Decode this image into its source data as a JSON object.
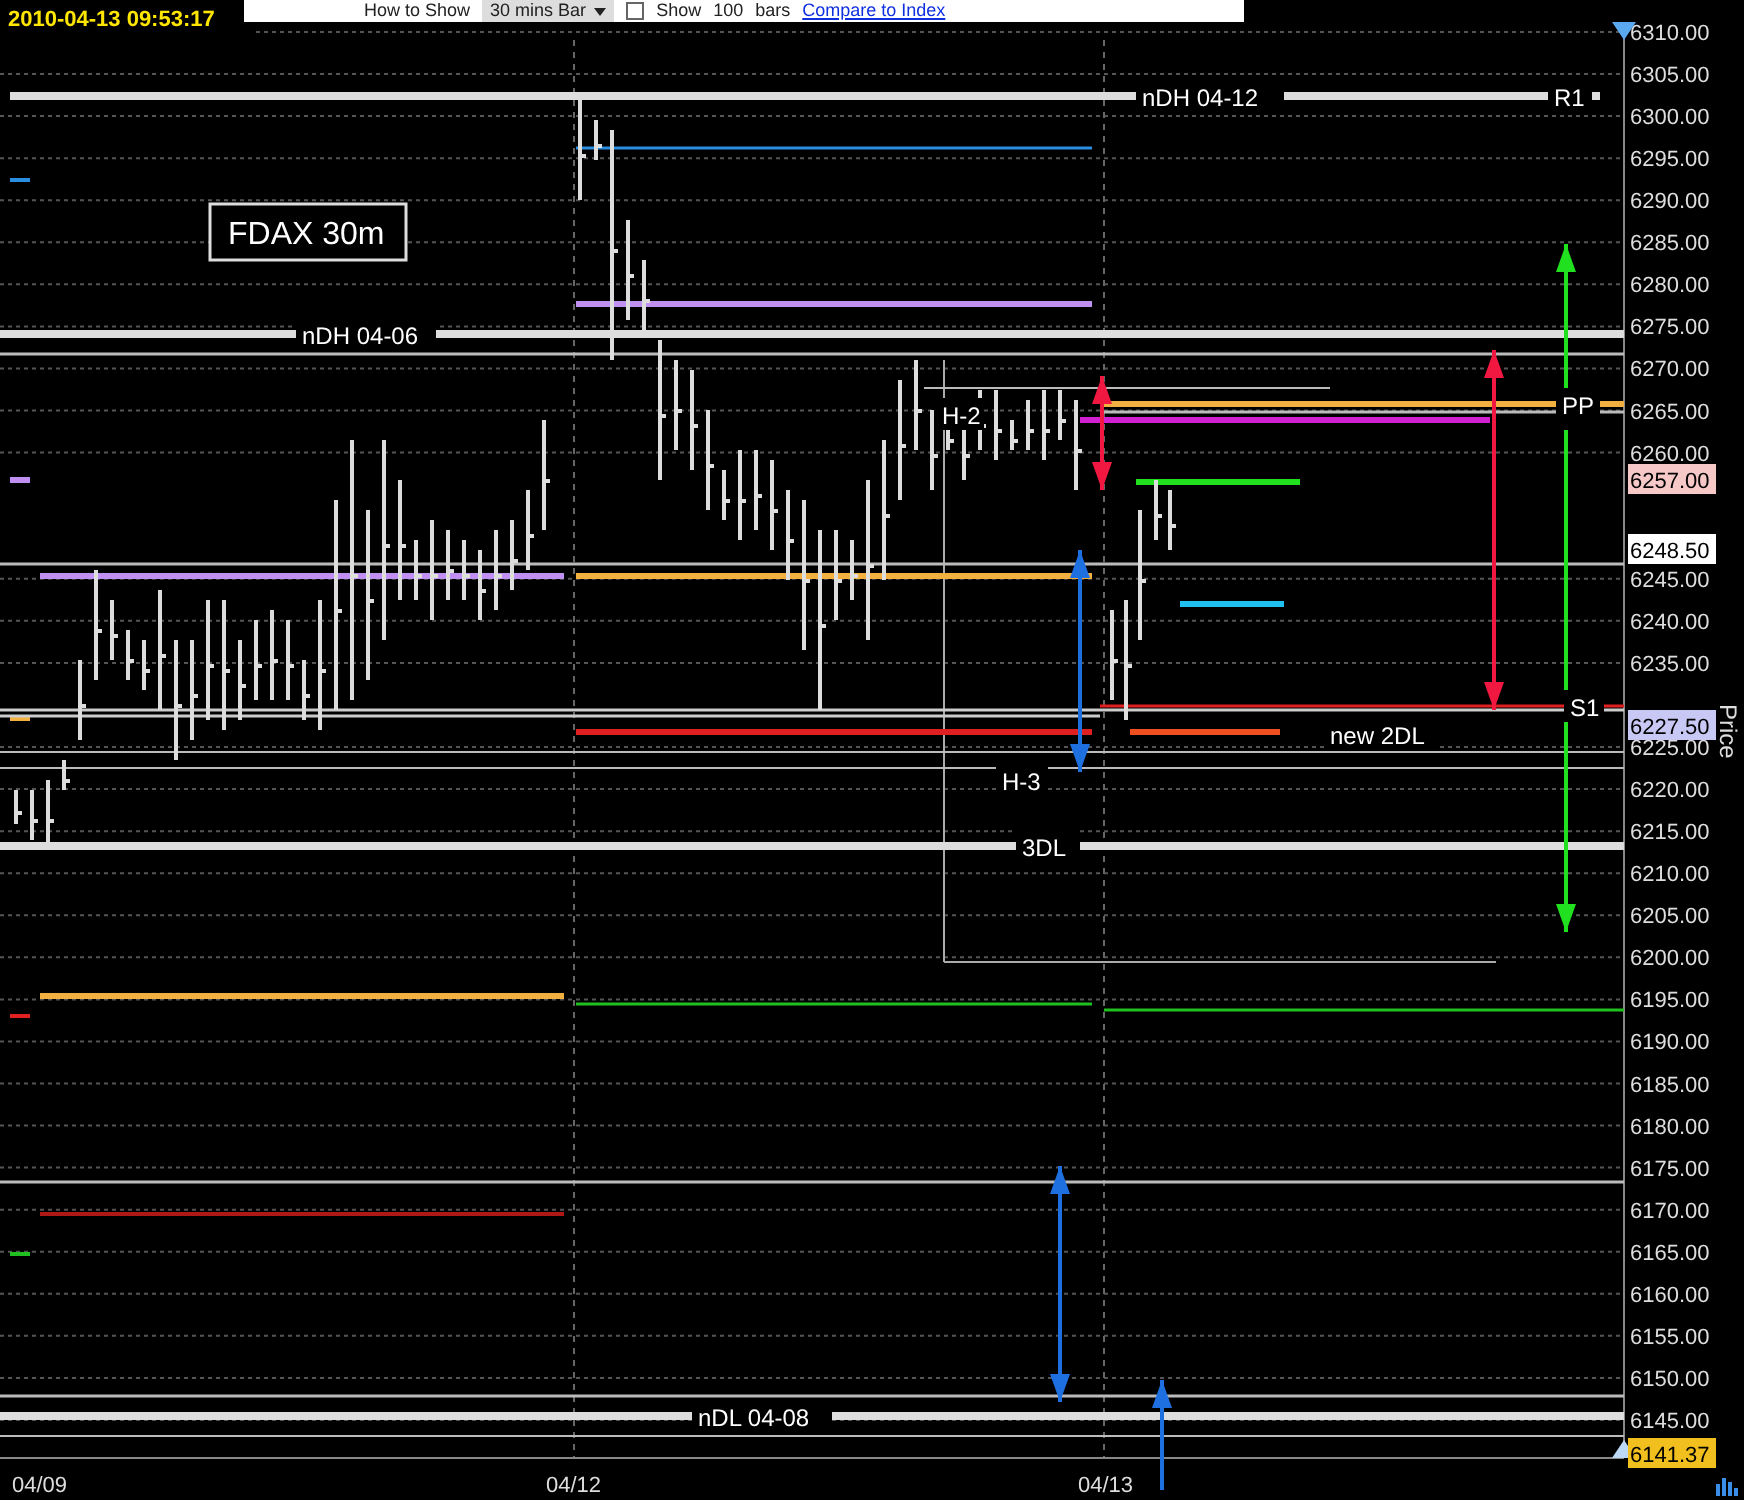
{
  "timestamp": "2010-04-13 09:53:17",
  "toolbar": {
    "how_to_show_label": "How to Show",
    "interval": "30 mins Bar",
    "show_checked": false,
    "show_label": "Show",
    "bars_count": "100",
    "bars_label": "bars",
    "compare_link": "Compare to Index"
  },
  "chart": {
    "title": "FDAX 30m",
    "axis_title": "Price",
    "y_ticks": [
      "6310.00",
      "6305.00",
      "6300.00",
      "6295.00",
      "6290.00",
      "6285.00",
      "6280.00",
      "6275.00",
      "6270.00",
      "6265.00",
      "6260.00",
      "6245.00",
      "6240.00",
      "6235.00",
      "6225.00",
      "6220.00",
      "6215.00",
      "6210.00",
      "6205.00",
      "6200.00",
      "6195.00",
      "6190.00",
      "6185.00",
      "6180.00",
      "6175.00",
      "6170.00",
      "6165.00",
      "6160.00",
      "6155.00",
      "6150.00",
      "6145.00"
    ],
    "x_labels": [
      "04/09",
      "04/12",
      "04/13"
    ],
    "level_labels": [
      "nDH 04-12",
      "R1",
      "nDH 04-06",
      "H-2",
      "PP",
      "S1",
      "new 2DL",
      "H-3",
      "3DL",
      "nDL 04-08"
    ],
    "price_tags": [
      {
        "text": "6257.00",
        "color": "#f6c8c8"
      },
      {
        "text": "6248.50",
        "color": "#ffffff"
      },
      {
        "text": "6227.50",
        "color": "#c8c8f4"
      },
      {
        "text": "6141.37",
        "color": "#f2c01e"
      }
    ]
  }
}
